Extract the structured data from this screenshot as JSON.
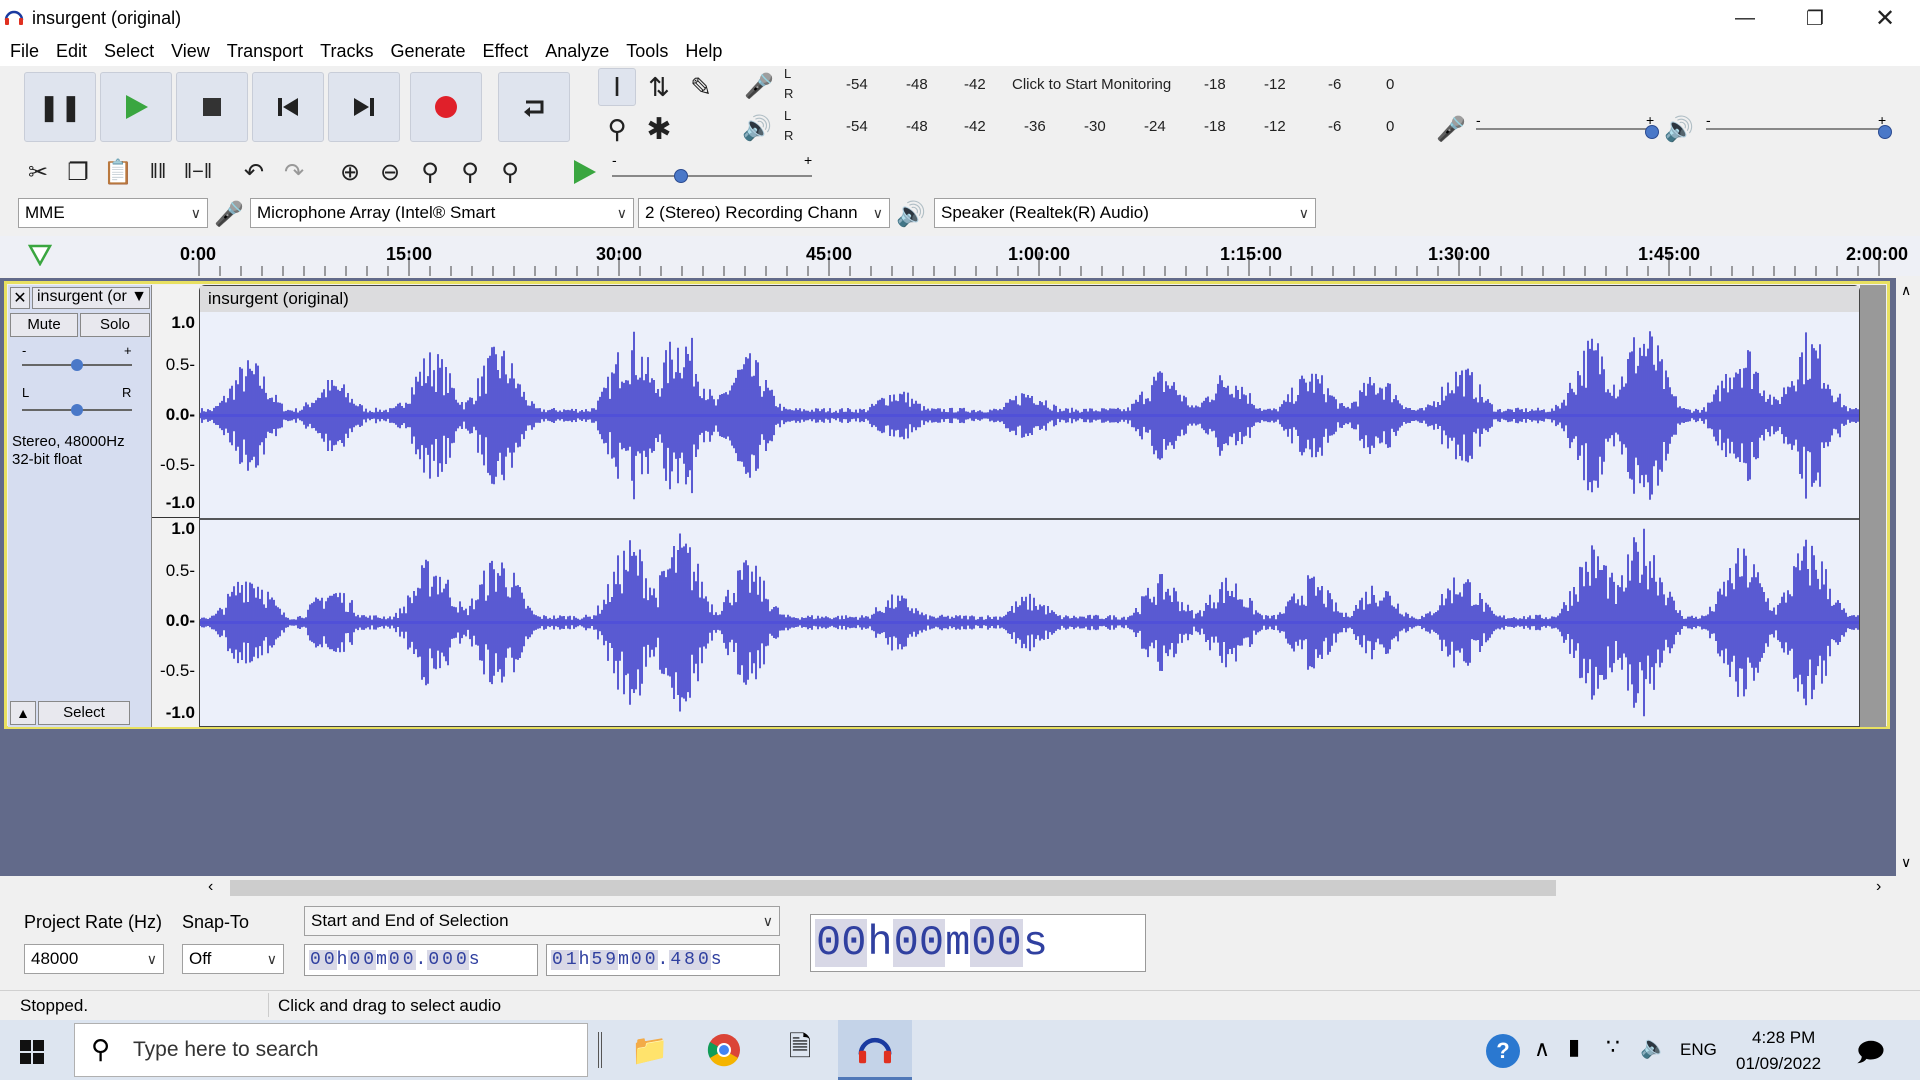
{
  "window": {
    "title": "insurgent (original)"
  },
  "menu": [
    "File",
    "Edit",
    "Select",
    "View",
    "Transport",
    "Tracks",
    "Generate",
    "Effect",
    "Analyze",
    "Tools",
    "Help"
  ],
  "record_meter": {
    "lr": [
      "L",
      "R"
    ],
    "scale": [
      "-54",
      "-48",
      "-42",
      "-18",
      "-12",
      "-6",
      "0"
    ],
    "monitor_label": "Click to Start Monitoring"
  },
  "play_meter": {
    "lr": [
      "L",
      "R"
    ],
    "scale": [
      "-54",
      "-48",
      "-42",
      "-36",
      "-30",
      "-24",
      "-18",
      "-12",
      "-6",
      "0"
    ]
  },
  "slider_signs": {
    "minus": "-",
    "plus": "+"
  },
  "device": {
    "host": "MME",
    "input": "Microphone Array (Intel® Smart",
    "channels": "2 (Stereo) Recording Chann",
    "output": "Speaker (Realtek(R) Audio)"
  },
  "timeline": [
    "0:00",
    "15:00",
    "30:00",
    "45:00",
    "1:00:00",
    "1:15:00",
    "1:30:00",
    "1:45:00",
    "2:00:00"
  ],
  "track": {
    "name": "insurgent (or",
    "clip_name": "insurgent (original)",
    "mute": "Mute",
    "solo": "Solo",
    "pan_l": "L",
    "pan_r": "R",
    "info1": "Stereo, 48000Hz",
    "info2": "32-bit float",
    "select": "Select",
    "scale": [
      "1.0",
      "0.5-",
      "0.0-",
      "-0.5-",
      "-1.0"
    ]
  },
  "selection_bar": {
    "rate_label": "Project Rate (Hz)",
    "rate_value": "48000",
    "snap_label": "Snap-To",
    "snap_value": "Off",
    "mode": "Start and End of Selection",
    "start": [
      "0",
      "0",
      "h",
      "0",
      "0",
      "m",
      "0",
      "0",
      ".",
      "0",
      "0",
      "0",
      "s"
    ],
    "end": [
      "0",
      "1",
      "h",
      "5",
      "9",
      "m",
      "0",
      "0",
      ".",
      "4",
      "8",
      "0",
      "s"
    ],
    "position": [
      "00",
      "h",
      "00",
      "m",
      "00",
      "s"
    ]
  },
  "status": {
    "left": "Stopped.",
    "right": "Click and drag to select audio"
  },
  "taskbar": {
    "search_placeholder": "Type here to search",
    "lang": "ENG",
    "time": "4:28 PM",
    "date": "01/09/2022"
  },
  "colors": {
    "waveform": "#3535c8",
    "track_border": "#e8e060",
    "track_bg": "#626a8a",
    "record": "#e0202a",
    "play": "#3aa640"
  }
}
